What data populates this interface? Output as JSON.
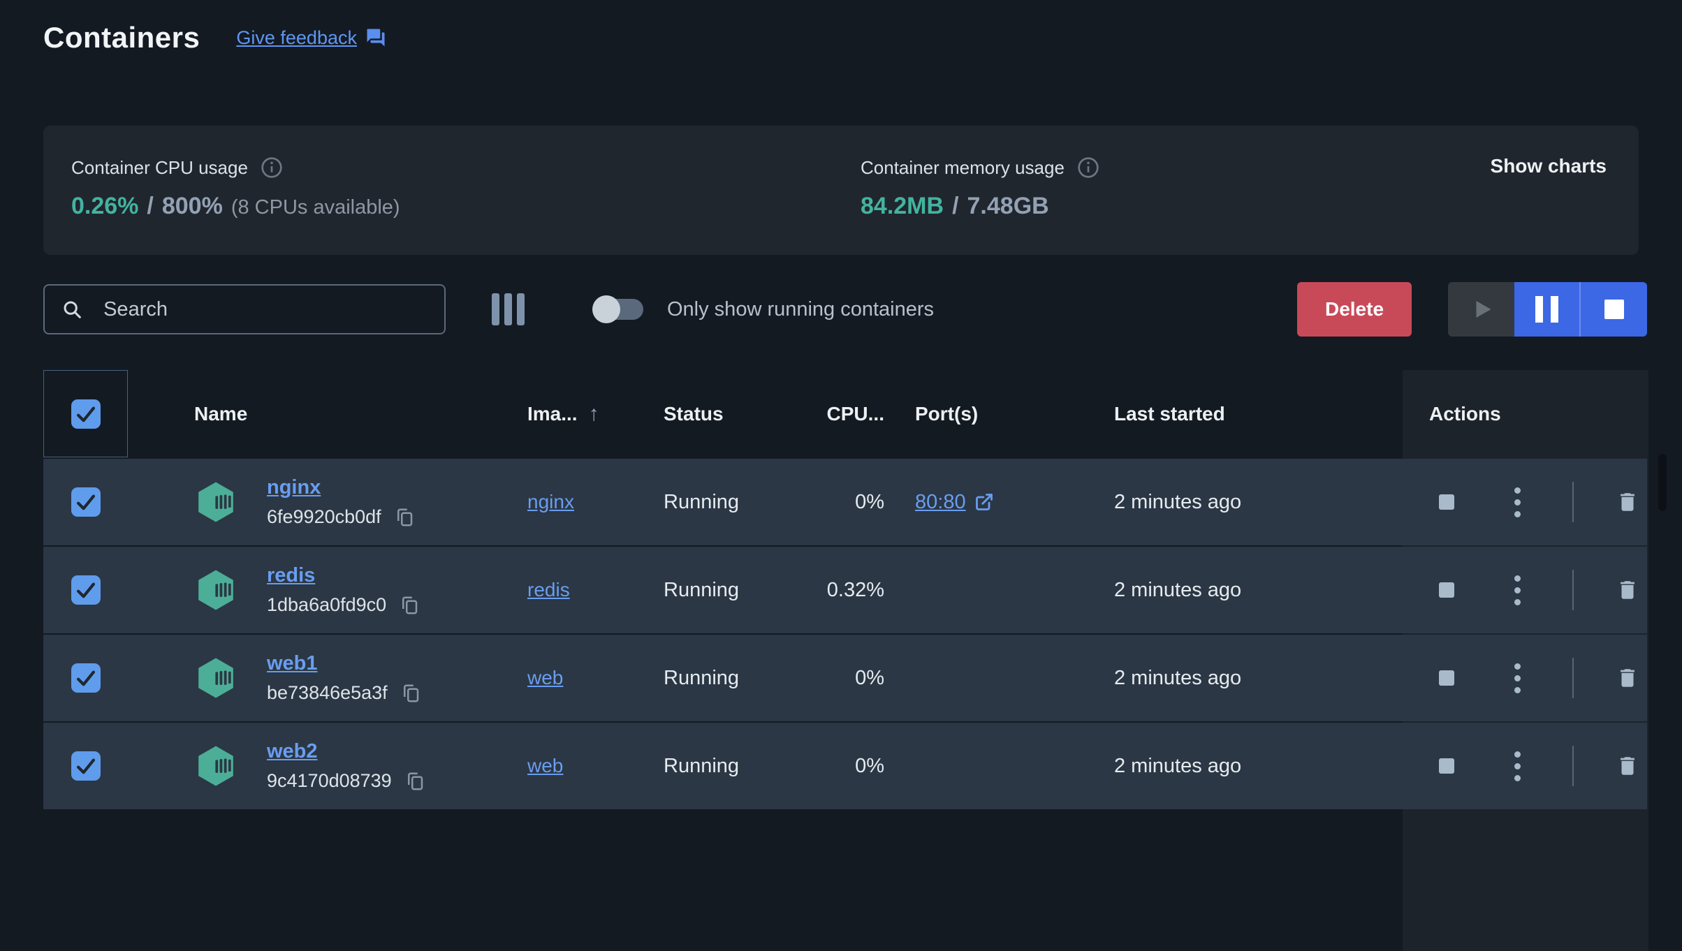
{
  "page": {
    "title": "Containers",
    "feedback_link": "Give feedback"
  },
  "stats": {
    "cpu": {
      "label": "Container CPU usage",
      "used": "0.26%",
      "sep": "/",
      "total": "800%",
      "note": "(8 CPUs available)"
    },
    "memory": {
      "label": "Container memory usage",
      "used": "84.2MB",
      "sep": "/",
      "total": "7.48GB"
    },
    "show_charts_label": "Show charts"
  },
  "toolbar": {
    "search_placeholder": "Search",
    "toggle_label": "Only show running containers",
    "toggle_on": false,
    "delete_label": "Delete",
    "play_enabled": false,
    "pause_enabled": true,
    "stop_enabled": true
  },
  "table": {
    "columns": {
      "name": "Name",
      "image": "Ima...",
      "image_sort": "asc",
      "status": "Status",
      "cpu": "CPU...",
      "ports": "Port(s)",
      "last_started": "Last started",
      "actions": "Actions"
    },
    "all_selected": true,
    "rows": [
      {
        "checked": true,
        "name": "nginx",
        "id": "6fe9920cb0df",
        "image": "nginx",
        "status": "Running",
        "cpu": "0%",
        "ports": "80:80",
        "last_started": "2 minutes ago"
      },
      {
        "checked": true,
        "name": "redis",
        "id": "1dba6a0fd9c0",
        "image": "redis",
        "status": "Running",
        "cpu": "0.32%",
        "ports": "",
        "last_started": "2 minutes ago"
      },
      {
        "checked": true,
        "name": "web1",
        "id": "be73846e5a3f",
        "image": "web",
        "status": "Running",
        "cpu": "0%",
        "ports": "",
        "last_started": "2 minutes ago"
      },
      {
        "checked": true,
        "name": "web2",
        "id": "9c4170d08739",
        "image": "web",
        "status": "Running",
        "cpu": "0%",
        "ports": "",
        "last_started": "2 minutes ago"
      }
    ]
  },
  "colors": {
    "background": "#141a22",
    "card": "#20262e",
    "row": "#2b3744",
    "accent_teal": "#43b3a0",
    "link_blue": "#699df0",
    "checkbox_blue": "#5f9ceb",
    "delete_red": "#c84a59",
    "action_blue": "#3c68e6",
    "container_icon_green": "#4cae97"
  }
}
